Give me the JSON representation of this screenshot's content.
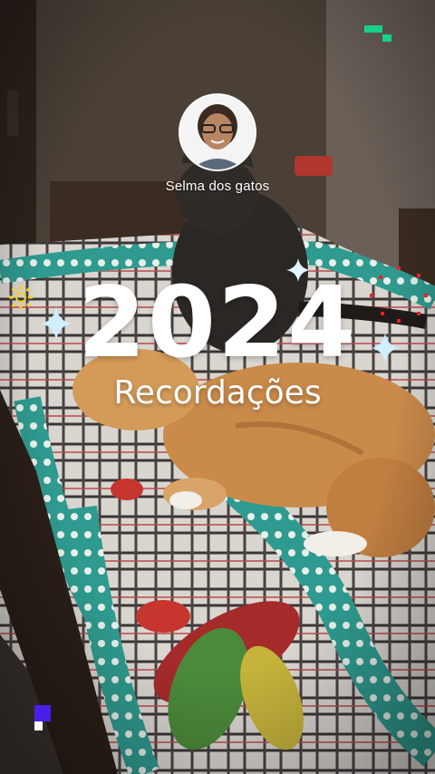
{
  "story": {
    "username": "Selma dos gatos",
    "year": "2024",
    "subtitle": "Recordações"
  },
  "colors": {
    "accent_green": "#19d08a",
    "accent_purple": "#4b1de8",
    "accent_yellow": "#f4cf2a",
    "accent_red": "#e8202a",
    "text": "#ffffff"
  },
  "decorations": [
    "sparkle-icon",
    "sun-flower-icon",
    "pixel-block-icon",
    "red-dot-cluster-icon"
  ]
}
